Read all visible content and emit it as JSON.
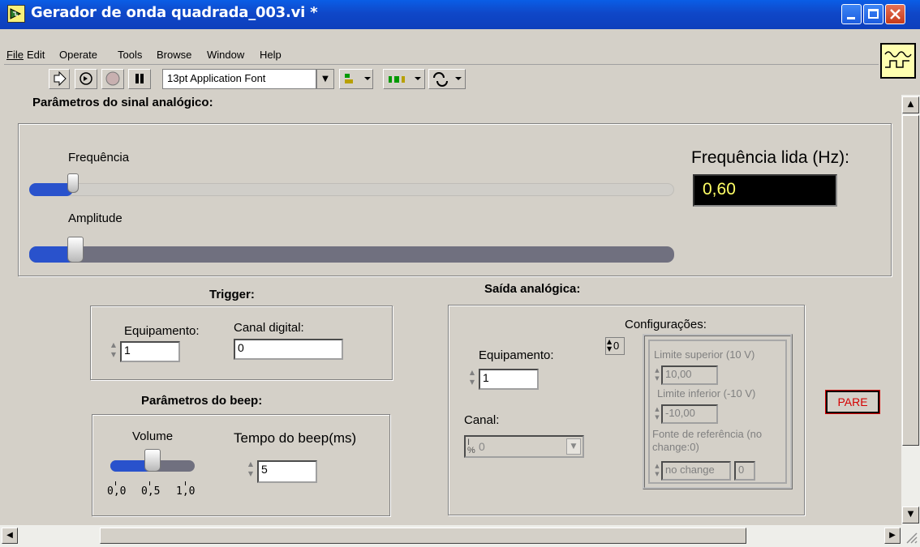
{
  "window": {
    "title": "Gerador de onda quadrada_003.vi *"
  },
  "menu": {
    "items": [
      "File",
      "Edit",
      "Operate",
      "Tools",
      "Browse",
      "Window",
      "Help"
    ]
  },
  "toolbar": {
    "font_select": "13pt Application Font"
  },
  "analog_params": {
    "heading": "Parâmetros do sinal analógico:",
    "frequency_label": "Frequência",
    "frequency_level": 0.06,
    "amplitude_label": "Amplitude",
    "amplitude_level": 0.06,
    "freq_read_label": "Frequência lida (Hz):",
    "freq_read_value": "0,60"
  },
  "trigger": {
    "heading": "Trigger:",
    "device_label": "Equipamento:",
    "device_value": "1",
    "digital_channel_label": "Canal digital:",
    "digital_channel_value": "0"
  },
  "beep": {
    "heading": "Parâmetros do beep:",
    "volume_label": "Volume",
    "volume_level": 0.5,
    "volume_ticks": [
      "0,0",
      "0,5",
      "1,0"
    ],
    "duration_label": "Tempo do beep(ms)",
    "duration_value": "5"
  },
  "analog_output": {
    "heading": "Saída analógica:",
    "device_label": "Equipamento:",
    "device_value": "1",
    "channel_label": "Canal:",
    "channel_value": "0",
    "config_label": "Configurações:",
    "config_index": "0",
    "upper_limit_label": "Limite superior (10 V)",
    "upper_limit_value": "10,00",
    "lower_limit_label": "Limite inferior (-10 V)",
    "lower_limit_value": "-10,00",
    "ref_source_label": "Fonte de referência (no change:0)",
    "ref_source_value": "no change",
    "ref_source_num": "0"
  },
  "stop_button": "PARE",
  "colors": {
    "title_bar": "#0d4fd6",
    "panel": "#d4d0c8",
    "indicator_bg": "#000000",
    "indicator_text": "#ffff66",
    "slider_fill": "#2952cc",
    "stop_text": "#d40000"
  }
}
